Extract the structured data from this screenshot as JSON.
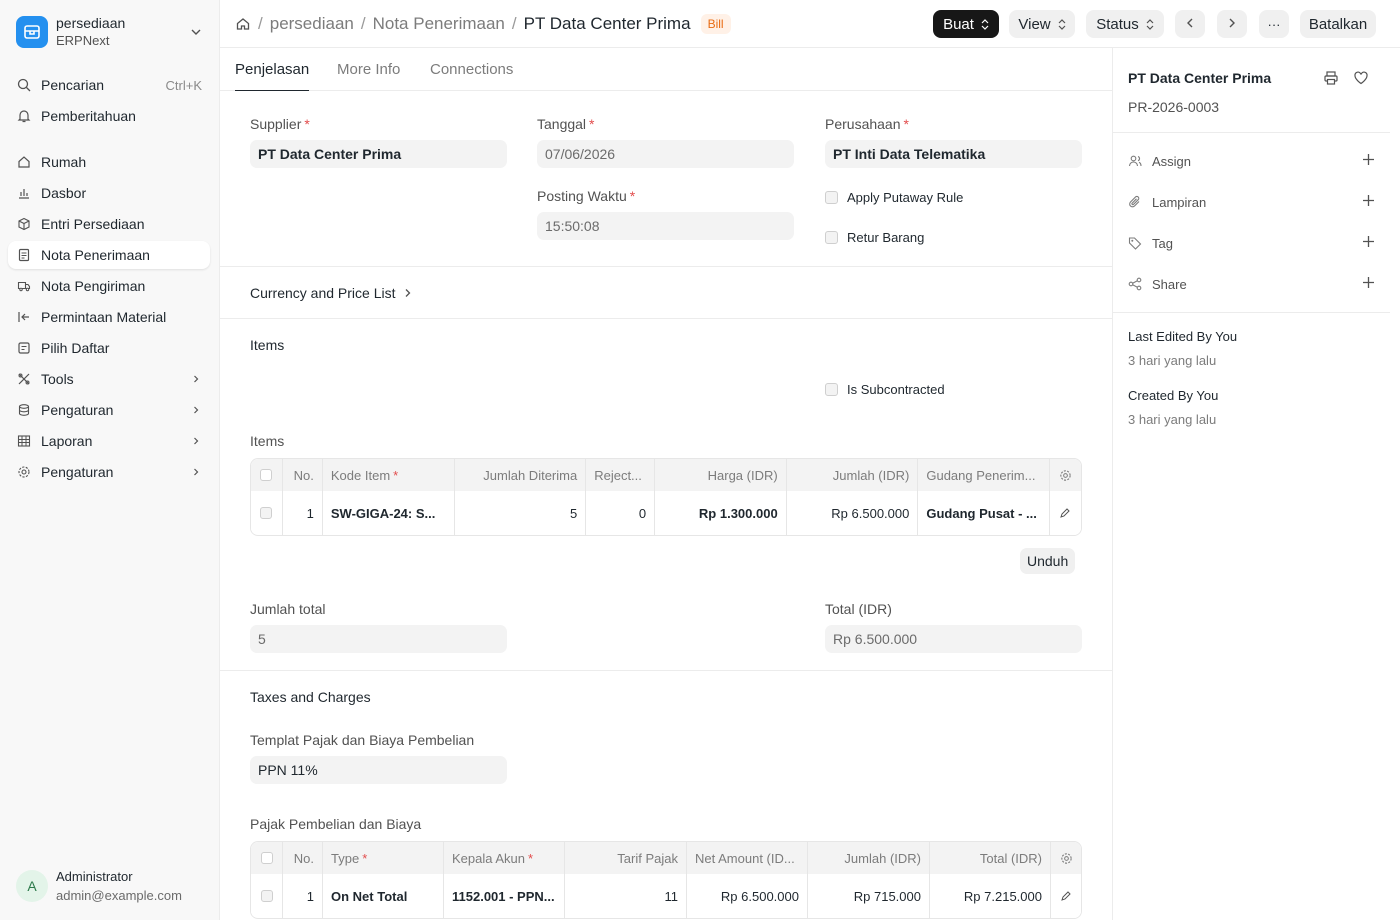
{
  "sidebar": {
    "app_name": "persediaan",
    "app_sub": "ERPNext",
    "search": {
      "label": "Pencarian",
      "shortcut": "Ctrl+K"
    },
    "notifications": "Pemberitahuan",
    "items": [
      {
        "label": "Rumah",
        "icon": "home-icon"
      },
      {
        "label": "Dasbor",
        "icon": "bar-chart-icon"
      },
      {
        "label": "Entri Persediaan",
        "icon": "box-icon"
      },
      {
        "label": "Nota Penerimaan",
        "icon": "document-icon",
        "active": true
      },
      {
        "label": "Nota Pengiriman",
        "icon": "truck-icon"
      },
      {
        "label": "Permintaan Material",
        "icon": "arrow-left-bar-icon"
      },
      {
        "label": "Pilih Daftar",
        "icon": "list-pick-icon"
      },
      {
        "label": "Tools",
        "icon": "tools-icon",
        "expandable": true
      },
      {
        "label": "Pengaturan",
        "icon": "database-icon",
        "expandable": true
      },
      {
        "label": "Laporan",
        "icon": "table-icon",
        "expandable": true
      },
      {
        "label": "Pengaturan",
        "icon": "gear-icon",
        "expandable": true
      }
    ],
    "user": {
      "initial": "A",
      "name": "Administrator",
      "email": "admin@example.com"
    }
  },
  "topbar": {
    "breadcrumbs": [
      "persediaan",
      "Nota Penerimaan"
    ],
    "title": "PT Data Center Prima",
    "status_badge": "Bill",
    "buttons": {
      "create": "Buat",
      "view": "View",
      "status": "Status",
      "more": "···",
      "cancel": "Batalkan"
    }
  },
  "tabs": [
    "Penjelasan",
    "More Info",
    "Connections"
  ],
  "form": {
    "supplier": {
      "label": "Supplier",
      "value": "PT Data Center Prima"
    },
    "date": {
      "label": "Tanggal",
      "value": "07/06/2026"
    },
    "posting_time": {
      "label": "Posting Waktu",
      "value": "15:50:08"
    },
    "company": {
      "label": "Perusahaan",
      "value": "PT Inti Data Telematika"
    },
    "apply_putaway": "Apply Putaway Rule",
    "return_goods": "Retur Barang",
    "currency_section": "Currency and Price List",
    "items_section": "Items",
    "is_subcontracted": "Is Subcontracted",
    "items_table_label": "Items",
    "items_table": {
      "headers": [
        "No.",
        "Kode Item",
        "Jumlah Diterima",
        "Reject...",
        "Harga (IDR)",
        "Jumlah (IDR)",
        "Gudang Penerim..."
      ],
      "rows": [
        {
          "no": "1",
          "item_code": "SW-GIGA-24: S...",
          "qty": "5",
          "rejected": "0",
          "rate": "Rp 1.300.000",
          "amount": "Rp 6.500.000",
          "warehouse": "Gudang Pusat - ..."
        }
      ]
    },
    "download": "Unduh",
    "total_qty": {
      "label": "Jumlah total",
      "value": "5"
    },
    "total": {
      "label": "Total (IDR)",
      "value": "Rp 6.500.000"
    },
    "taxes_section": "Taxes and Charges",
    "tax_template": {
      "label": "Templat Pajak dan Biaya Pembelian",
      "value": "PPN 11%"
    },
    "taxes_table_label": "Pajak Pembelian dan Biaya",
    "taxes_table": {
      "headers": [
        "No.",
        "Type",
        "Kepala Akun",
        "Tarif Pajak",
        "Net Amount (ID...",
        "Jumlah (IDR)",
        "Total (IDR)"
      ],
      "rows": [
        {
          "no": "1",
          "type": "On Net Total",
          "account": "1152.001 - PPN...",
          "rate": "11",
          "net": "Rp 6.500.000",
          "amount": "Rp 715.000",
          "total": "Rp 7.215.000"
        }
      ]
    }
  },
  "right_panel": {
    "title": "PT Data Center Prima",
    "doc_id": "PR-2026-0003",
    "rows": [
      "Assign",
      "Lampiran",
      "Tag",
      "Share"
    ],
    "last_edited": "Last Edited By You",
    "last_edited_time": "3 hari yang lalu",
    "created": "Created By You",
    "created_time": "3 hari yang lalu"
  },
  "colors": {
    "accent": "#2490ef",
    "badge_bg": "#fff1e7",
    "badge_text": "#e86c13",
    "required": "#e24c4c"
  }
}
